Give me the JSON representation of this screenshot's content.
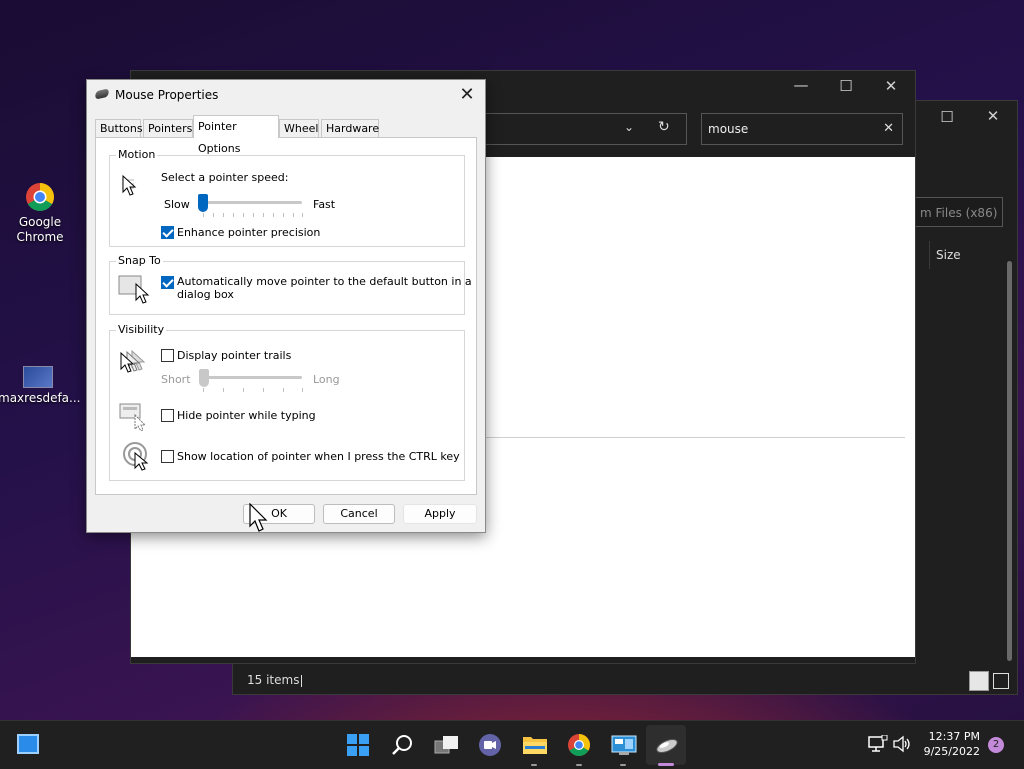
{
  "desktop": {
    "icons": [
      {
        "label": "Google Chrome",
        "icon": "chrome-icon"
      },
      {
        "label": "maxresdefa...",
        "icon": "image-file-icon"
      }
    ]
  },
  "explorer_back": {
    "search_result_partial": "m Files (x86)",
    "column_size": "Size",
    "status": "15 items"
  },
  "explorer_front": {
    "search_value": "mouse"
  },
  "dialog": {
    "title": "Mouse Properties",
    "tabs": [
      "Buttons",
      "Pointers",
      "Pointer Options",
      "Wheel",
      "Hardware"
    ],
    "active_tab": "Pointer Options",
    "motion": {
      "group": "Motion",
      "speed_label": "Select a pointer speed:",
      "slow": "Slow",
      "fast": "Fast",
      "speed_value": 0,
      "precision": {
        "label": "Enhance pointer precision",
        "checked": true
      }
    },
    "snap_to": {
      "group": "Snap To",
      "label_line1": "Automatically move pointer to the default button in a",
      "label_line2": "dialog box",
      "checked": true
    },
    "visibility": {
      "group": "Visibility",
      "trails": {
        "label": "Display pointer trails",
        "checked": false
      },
      "short": "Short",
      "long": "Long",
      "hide_typing": {
        "label": "Hide pointer while typing",
        "checked": false
      },
      "show_location": {
        "label": "Show location of pointer when I press the CTRL key",
        "checked": false
      }
    },
    "buttons": {
      "ok": "OK",
      "cancel": "Cancel",
      "apply": "Apply"
    }
  },
  "taskbar": {
    "time": "12:37 PM",
    "date": "9/25/2022",
    "notifications": "2"
  },
  "colors": {
    "accent": "#0067c0",
    "dark_chrome": "#1f1f1f",
    "taskbar": "#202020"
  }
}
